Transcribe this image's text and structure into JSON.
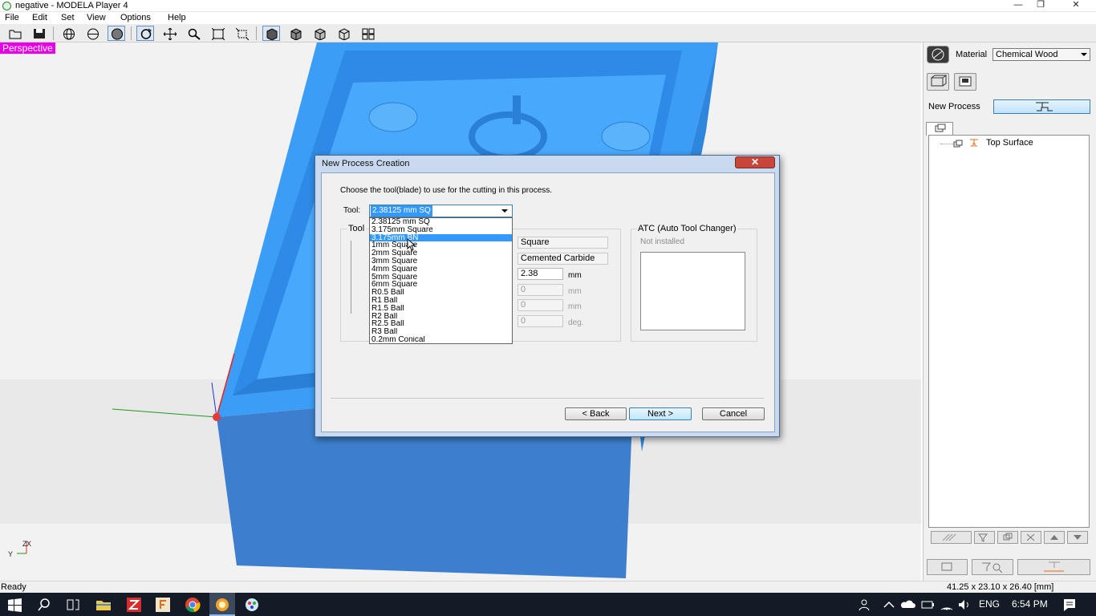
{
  "window": {
    "title": "negative - MODELA Player 4",
    "controls": {
      "minimize": "—",
      "maximize": "❐",
      "close": "✕"
    }
  },
  "menu": [
    "File",
    "Edit",
    "Set",
    "View",
    "Options",
    "Help"
  ],
  "toolbar": {
    "buttons": [
      "open-icon",
      "save-icon",
      "globe-icon",
      "sphere-icon",
      "shaded-sphere-icon",
      "rotate-icon",
      "pan-icon",
      "zoom-icon",
      "fit-icon",
      "zoom-box-icon",
      "cube-front-icon",
      "cube-right-icon",
      "cube-left-icon",
      "cube-back-icon",
      "multi-view-icon"
    ]
  },
  "viewport": {
    "label": "Perspective",
    "axis_labels": {
      "z": "Z",
      "x": "X",
      "y": "Y"
    },
    "colors": {
      "model": "#3d9cf3",
      "model_dark": "#3478c2",
      "background": "#f2f2f2",
      "label_bg": "#e800e8"
    }
  },
  "right_panel": {
    "material_label": "Material",
    "material_value": "Chemical Wood",
    "new_process_label": "New Process",
    "tree": {
      "item": "Top Surface"
    }
  },
  "status": {
    "left": "Ready",
    "right": "41.25 x 23.10 x 26.40 [mm]"
  },
  "taskbar": {
    "lang": "ENG",
    "time": "6:54 PM"
  },
  "dialog": {
    "title": "New Process Creation",
    "close": "✕",
    "instruction": "Choose the tool(blade) to use for the cutting in this process.",
    "tool_label": "Tool:",
    "tool_value": "2.38125 mm SQ",
    "tool_group_label": "Tool",
    "fields": {
      "shape": "Square",
      "material": "Cemented Carbide",
      "diameter": "2.38",
      "diameter_unit": "mm",
      "f2": "0",
      "f2_unit": "mm",
      "f3": "0",
      "f3_unit": "mm",
      "f4": "0",
      "f4_unit": "deg."
    },
    "atc_label": "ATC (Auto Tool Changer)",
    "atc_status": "Not installed",
    "buttons": {
      "back": "< Back",
      "next": "Next >",
      "cancel": "Cancel"
    },
    "tool_options": [
      "2.38125 mm SQ",
      "3.175mm Square",
      "3.175mm BN",
      "1mm Square",
      "2mm Square",
      "3mm Square",
      "4mm Square",
      "5mm Square",
      "6mm Square",
      "R0.5 Ball",
      "R1 Ball",
      "R1.5 Ball",
      "R2 Ball",
      "R2.5 Ball",
      "R3 Ball",
      "0.2mm Conical"
    ],
    "highlighted_option": "3.175mm BN"
  }
}
